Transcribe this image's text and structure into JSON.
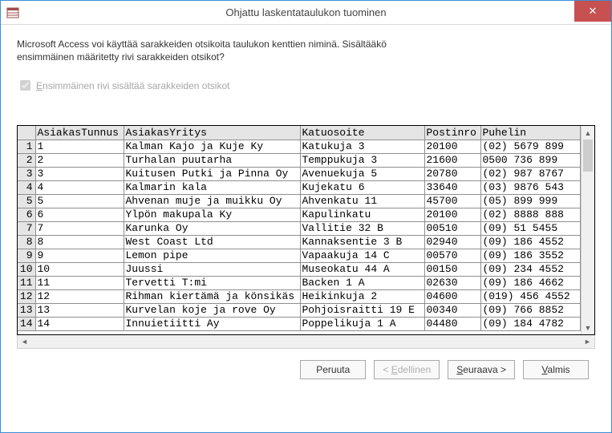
{
  "window": {
    "title": "Ohjattu laskentataulukon tuominen"
  },
  "intro": {
    "line1": "Microsoft Access voi käyttää sarakkeiden otsikoita taulukon kenttien niminä. Sisältääkö",
    "line2": "ensimmäinen määritetty rivi sarakkeiden otsikot?"
  },
  "checkbox": {
    "prefix": "E",
    "rest": "nsimmäinen rivi sisältää sarakkeiden otsikot",
    "checked": true
  },
  "columns": [
    "AsiakasTunnus",
    "AsiakasYritys",
    "Katuosoite",
    "Postinro",
    "Puhelin"
  ],
  "rows": [
    {
      "n": "1",
      "id": "1",
      "comp": "Kalman Kajo ja Kuje Ky",
      "addr": "Katukuja 3",
      "zip": "20100",
      "phone": "(02) 5679 899"
    },
    {
      "n": "2",
      "id": "2",
      "comp": "Turhalan puutarha",
      "addr": "Temppukuja 3",
      "zip": "21600",
      "phone": "0500 736 899"
    },
    {
      "n": "3",
      "id": "3",
      "comp": "Kuitusen Putki ja Pinna Oy",
      "addr": "Avenuekuja 5",
      "zip": "20780",
      "phone": "(02) 987 8767"
    },
    {
      "n": "4",
      "id": "4",
      "comp": "Kalmarin kala",
      "addr": "Kujekatu 6",
      "zip": "33640",
      "phone": "(03) 9876 543"
    },
    {
      "n": "5",
      "id": "5",
      "comp": "Ahvenan muje ja muikku Oy",
      "addr": "Ahvenkatu 11",
      "zip": "45700",
      "phone": "(05) 899 999"
    },
    {
      "n": "6",
      "id": "6",
      "comp": "Ylpön makupala Ky",
      "addr": "Kapulinkatu",
      "zip": "20100",
      "phone": "(02) 8888 888"
    },
    {
      "n": "7",
      "id": "7",
      "comp": "Karunka Oy",
      "addr": "Vallitie 32 B",
      "zip": "00510",
      "phone": "(09) 51 5455"
    },
    {
      "n": "8",
      "id": "8",
      "comp": "West Coast Ltd",
      "addr": "Kannaksentie 3 B",
      "zip": "02940",
      "phone": "(09) 186 4552"
    },
    {
      "n": "9",
      "id": "9",
      "comp": "Lemon pipe",
      "addr": "Vapaakuja 14 C",
      "zip": "00570",
      "phone": "(09) 186 3552"
    },
    {
      "n": "10",
      "id": "10",
      "comp": "Juussi",
      "addr": "Museokatu 44 A",
      "zip": "00150",
      "phone": "(09) 234 4552"
    },
    {
      "n": "11",
      "id": "11",
      "comp": "Tervetti T:mi",
      "addr": "Backen 1 A",
      "zip": "02630",
      "phone": "(09) 186 4662"
    },
    {
      "n": "12",
      "id": "12",
      "comp": "Rihman kiertämä ja könsikäs",
      "addr": "Heikinkuja 2",
      "zip": "04600",
      "phone": "(019) 456 4552"
    },
    {
      "n": "13",
      "id": "13",
      "comp": "Kurvelan koje ja rove Oy",
      "addr": "Pohjoisraitti 19 E",
      "zip": "00340",
      "phone": "(09) 766 8852"
    },
    {
      "n": "14",
      "id": "14",
      "comp": "Innuietiitti Ay",
      "addr": "Poppelikuja 1 A",
      "zip": "04480",
      "phone": "(09) 184 4782"
    }
  ],
  "buttons": {
    "cancel": "Peruuta",
    "prev_prefix": "< ",
    "prev_ul": "E",
    "prev_rest": "dellinen",
    "next_ul": "S",
    "next_rest": "euraava >",
    "finish_ul": "V",
    "finish_rest": "almis"
  }
}
